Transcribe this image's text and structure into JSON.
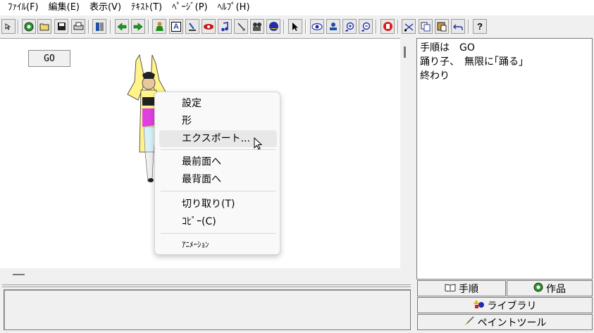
{
  "menu": [
    "ﾌｧｲﾙ(F)",
    "編集(E)",
    "表示(V)",
    "ﾃｷｽﾄ(T)",
    "ﾍﾟｰｼﾞ(P)",
    "ﾍﾙﾌﾟ(H)"
  ],
  "toolbar": {
    "icons": [
      "pointer-arrow-icon",
      "globe-icon",
      "open-folder-icon",
      "save-disk-icon",
      "print-icon",
      "layout-icon",
      "back-arrow-icon",
      "forward-arrow-icon",
      "character-icon",
      "text-a-icon",
      "paint-icon",
      "eye-mask-icon",
      "music-note-icon",
      "brush-icon",
      "movie-camera-icon",
      "sphere-icon",
      "select-cursor-icon",
      "view-eye-icon",
      "stamp-icon",
      "zoom-in-icon",
      "zoom-out-icon",
      "stop-hand-icon",
      "cut-icon",
      "copy-icon",
      "paste-icon",
      "undo-icon",
      "help-icon"
    ],
    "text_a": "A",
    "help": "?"
  },
  "canvas": {
    "go_button": "GO"
  },
  "context_menu": {
    "items": [
      "設定",
      "形",
      "エクスポート...",
      "最前面へ",
      "最背面へ",
      "切り取り(T)",
      "ｺﾋﾟｰ(C)",
      "ｱﾆﾒｰｼｮﾝ"
    ]
  },
  "script": {
    "lines": [
      "手順は　GO",
      "踊り子、　無限に｢踊る｣",
      "終わり"
    ]
  },
  "tabs": {
    "procedure": "手順",
    "works": "作品",
    "library": "ライブラリ",
    "paint_tool": "ペイントツール"
  },
  "colors": {
    "accent_green": "#1c9a1c",
    "dancer_yellow": "#fff38a",
    "dancer_magenta": "#e040e0"
  }
}
